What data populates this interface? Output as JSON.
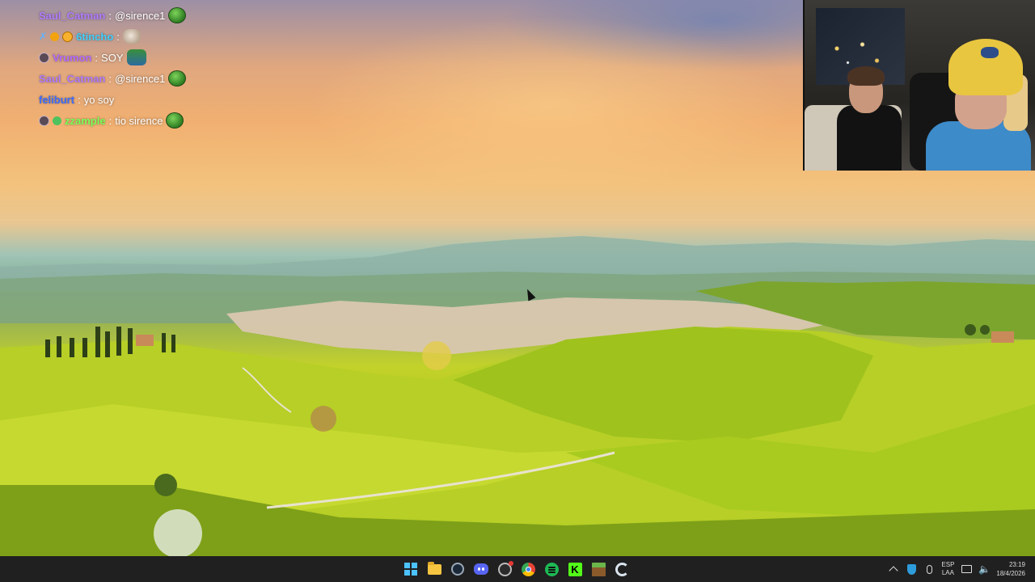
{
  "chat": {
    "messages": [
      {
        "user": "Saul_Catman",
        "user_color": "#b07cff",
        "separator": ":",
        "text": "@sirence1",
        "badges": [],
        "emote": "frog-emote"
      },
      {
        "user": "6tincho",
        "user_color": "#3fd0ff",
        "separator": ":",
        "text": "",
        "badges": [
          "sword-badge",
          "orange-badge",
          "orange-badge-2"
        ],
        "emote": "dog-emote"
      },
      {
        "user": "Vrumon",
        "user_color": "#b26bff",
        "separator": ":",
        "text": "SOY",
        "badges": [
          "grey-badge"
        ],
        "emote": "pepe-emote"
      },
      {
        "user": "Saul_Catman",
        "user_color": "#b07cff",
        "separator": ":",
        "text": "@sirence1",
        "badges": [],
        "emote": "frog-emote"
      },
      {
        "user": "feliburt",
        "user_color": "#3d6cff",
        "separator": ":",
        "text": "yo soy",
        "badges": [],
        "emote": ""
      },
      {
        "user": "zzample",
        "user_color": "#7cff5a",
        "separator": ":",
        "text": "tio sirence",
        "badges": [
          "grey-badge",
          "green-badge"
        ],
        "emote": "frog-emote"
      }
    ]
  },
  "taskbar": {
    "apps": [
      {
        "name": "start-button",
        "icon": "windows-icon"
      },
      {
        "name": "file-explorer",
        "icon": "folder-icon"
      },
      {
        "name": "steam",
        "icon": "steam-icon"
      },
      {
        "name": "discord",
        "icon": "discord-icon"
      },
      {
        "name": "obs",
        "icon": "obs-icon"
      },
      {
        "name": "chrome",
        "icon": "chrome-icon"
      },
      {
        "name": "spotify",
        "icon": "spotify-icon"
      },
      {
        "name": "kick",
        "icon": "kick-icon"
      },
      {
        "name": "minecraft",
        "icon": "minecraft-icon"
      },
      {
        "name": "ccleaner",
        "icon": "ccleaner-icon"
      }
    ],
    "kick_letter": "K",
    "tray": {
      "lang_top": "ESP",
      "lang_bottom": "LAA",
      "time": "23:19",
      "date": "18/4/2026"
    }
  }
}
